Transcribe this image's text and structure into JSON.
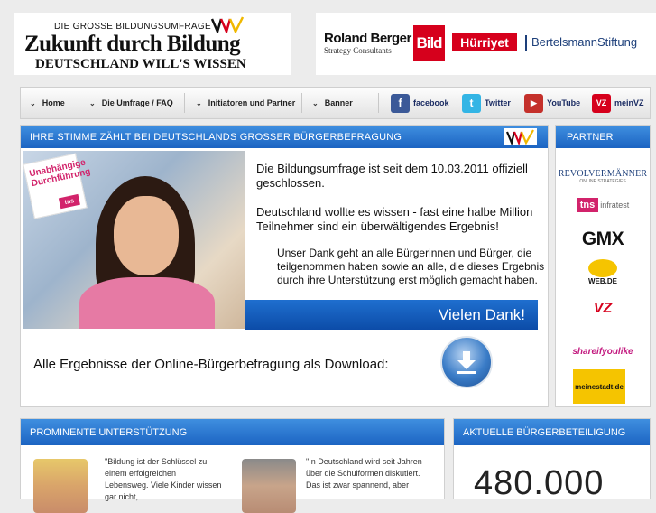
{
  "header": {
    "logo_small": "DIE GROSSE BILDUNGSUMFRAGE",
    "logo_title": "Zukunft durch Bildung",
    "logo_subtitle": "DEUTSCHLAND WILL'S WISSEN",
    "partners": {
      "rb_title": "Roland Berger",
      "rb_sub": "Strategy Consultants",
      "bild": "Bild",
      "hurriyet": "Hürriyet",
      "bertelsmann": "BertelsmannStiftung"
    }
  },
  "nav": {
    "items": [
      {
        "label": "Home"
      },
      {
        "label": "Die Umfrage / FAQ"
      },
      {
        "label": "Initiatoren und Partner"
      },
      {
        "label": "Banner"
      }
    ],
    "social": [
      {
        "label": "facebook",
        "icon": "f",
        "color": "#3b5998"
      },
      {
        "label": "Twitter",
        "icon": "t",
        "color": "#33b5e5"
      },
      {
        "label": "YouTube",
        "icon": "▶",
        "color": "#c4302b"
      },
      {
        "label": "meinVZ",
        "icon": "VZ",
        "color": "#d6001c"
      }
    ]
  },
  "main": {
    "heading": "IHRE STIMME ZÄHLT BEI DEUTSCHLANDS GROSSER BÜRGERBEFRAGUNG",
    "badge_text": "Unabhängige Durchführung",
    "badge_tns": "tns",
    "p1": "Die Bildungsumfrage ist seit dem 10.03.2011 offiziell geschlossen.",
    "p2": "Deutschland wollte es wissen - fast eine halbe Million Teilnehmer sind ein überwältigendes Ergebnis!",
    "p3": "Unser Dank geht an alle Bürgerinnen und Bürger, die teilgenommen haben sowie an alle, die dieses Ergebnis durch ihre Unterstützung erst möglich gemacht haben.",
    "thanks": "Vielen Dank!",
    "download_text": "Alle Ergebnisse der Online-Bürgerbefragung als Download:"
  },
  "partner_panel": {
    "heading": "PARTNER",
    "revolver": "REVOLVERMÄNNER",
    "revolver_sub": "ONLINE STRATEGIES",
    "tns": "tns",
    "tns_sub": "infratest",
    "gmx": "GMX",
    "webde": "WEB.DE",
    "vz": "VZ",
    "shareifyoulike": "shareifyoulike",
    "meinestadt": "meinestadt.de"
  },
  "prominent": {
    "heading": "PROMINENTE UNTERSTÜTZUNG",
    "quote1": "\"Bildung ist der Schlüssel zu einem erfolgreichen Lebensweg. Viele Kinder wissen gar nicht,",
    "quote2": "\"In Deutschland wird seit Jahren über die Schulformen diskutiert. Das ist zwar spannend, aber"
  },
  "aktuell": {
    "heading": "AKTUELLE BÜRGERBETEILIGUNG",
    "count": "480.000"
  }
}
